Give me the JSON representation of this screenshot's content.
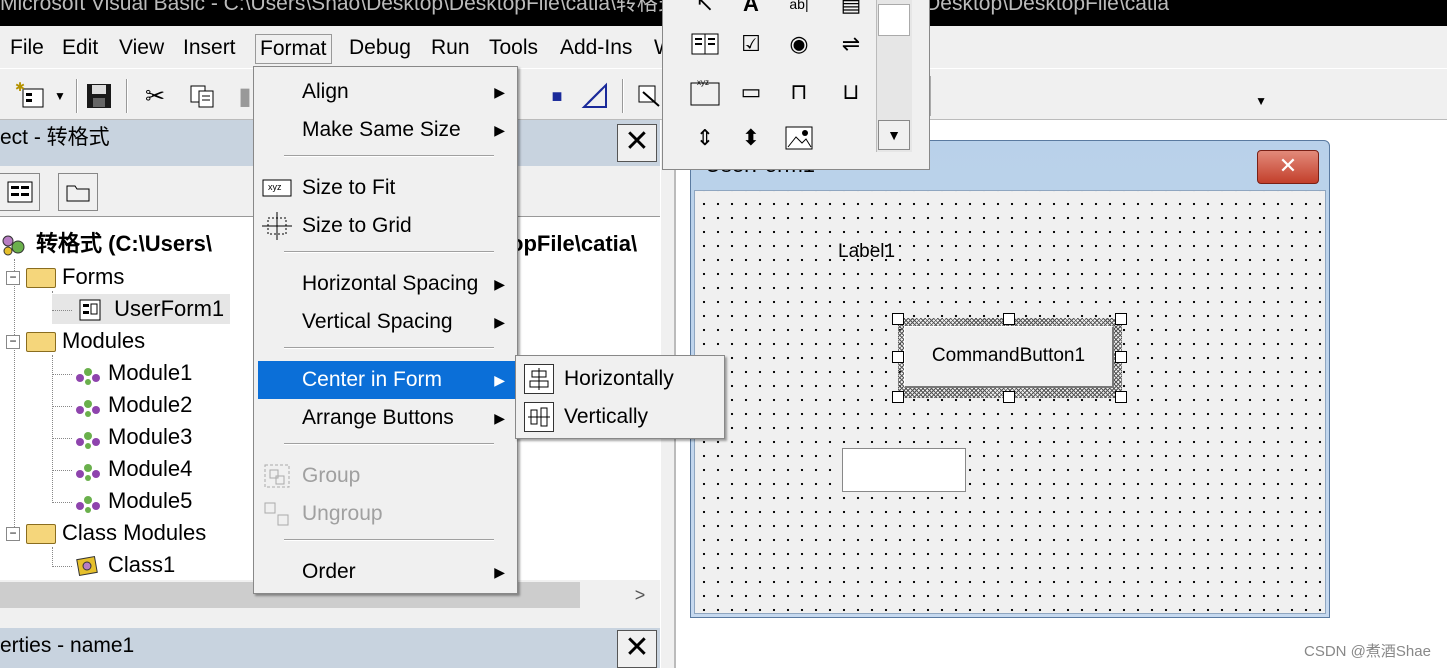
{
  "window": {
    "title": "Microsoft Visual Basic - C:\\Users\\Shao\\Desktop\\DesktopFile\\catia\\转格式 [design] - [C:\\Users\\Shao\\Desktop\\DesktopFile\\catia"
  },
  "menubar": {
    "items": [
      "File",
      "Edit",
      "View",
      "Insert",
      "Format",
      "Debug",
      "Run",
      "Tools",
      "Add-Ins",
      "W"
    ]
  },
  "project_explorer": {
    "title": "ect - 转格式",
    "close_label": "✕",
    "root": "转格式 (C:\\Users\\",
    "root_tail": "opFile\\catia\\",
    "folders": {
      "forms": "Forms",
      "modules": "Modules",
      "class_modules": "Class Modules"
    },
    "forms": [
      "UserForm1"
    ],
    "modules": [
      "Module1",
      "Module2",
      "Module3",
      "Module4",
      "Module5"
    ],
    "classes": [
      "Class1"
    ]
  },
  "properties": {
    "title": "erties - name1",
    "close_label": "✕"
  },
  "format_menu": {
    "items": [
      {
        "label": "Align",
        "submenu": true,
        "enabled": true
      },
      {
        "label": "Make Same Size",
        "submenu": true,
        "enabled": true
      },
      {
        "label": "Size to Fit",
        "submenu": false,
        "enabled": true
      },
      {
        "label": "Size to Grid",
        "submenu": false,
        "enabled": true
      },
      {
        "label": "Horizontal Spacing",
        "submenu": true,
        "enabled": true
      },
      {
        "label": "Vertical Spacing",
        "submenu": true,
        "enabled": true
      },
      {
        "label": "Center in Form",
        "submenu": true,
        "enabled": true,
        "highlighted": true
      },
      {
        "label": "Arrange Buttons",
        "submenu": true,
        "enabled": true
      },
      {
        "label": "Group",
        "submenu": false,
        "enabled": false
      },
      {
        "label": "Ungroup",
        "submenu": false,
        "enabled": false
      },
      {
        "label": "Order",
        "submenu": true,
        "enabled": true
      }
    ]
  },
  "center_submenu": {
    "items": [
      "Horizontally",
      "Vertically"
    ]
  },
  "userform": {
    "title": "UserForm1",
    "close_label": "✕",
    "label1": "Label1",
    "command_button": "CommandButton1"
  },
  "watermark": "CSDN @煮酒Shae",
  "colors": {
    "menu_highlight": "#0b6fd8",
    "panel_title": "#c8d3df",
    "close_red": "#c33f2b"
  }
}
